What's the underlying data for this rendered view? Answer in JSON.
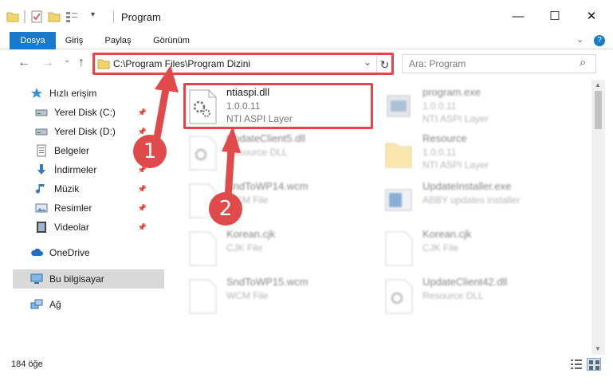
{
  "window": {
    "title": "Program",
    "minimize": "—",
    "maximize": "☐",
    "close": "✕"
  },
  "ribbon": {
    "tabs": [
      "Dosya",
      "Giriş",
      "Paylaş",
      "Görünüm"
    ],
    "collapse": "⌄",
    "help": "?"
  },
  "nav": {
    "back": "←",
    "forward": "→",
    "recent": "⌄",
    "up": "↑",
    "address": "C:\\Program Files\\Program Dizini",
    "address_dropdown": "⌄",
    "refresh": "↻",
    "search_placeholder": "Ara: Program",
    "search_icon": "⌕"
  },
  "sidebar": {
    "items": [
      {
        "label": "Hızlı erişim",
        "icon": "star-icon"
      },
      {
        "label": "Yerel Disk (C:)",
        "icon": "drive-icon"
      },
      {
        "label": "Yerel Disk (D:)",
        "icon": "drive-icon"
      },
      {
        "label": "Belgeler",
        "icon": "documents-icon"
      },
      {
        "label": "İndirmeler",
        "icon": "download-icon"
      },
      {
        "label": "Müzik",
        "icon": "music-icon"
      },
      {
        "label": "Resimler",
        "icon": "pictures-icon"
      },
      {
        "label": "Videolar",
        "icon": "video-icon"
      },
      {
        "label": "OneDrive",
        "icon": "cloud-icon"
      },
      {
        "label": "Bu bilgisayar",
        "icon": "computer-icon"
      },
      {
        "label": "Ağ",
        "icon": "network-icon"
      }
    ]
  },
  "files": [
    {
      "name": "ntiaspi.dll",
      "line2": "1.0.0.11",
      "line3": "NTI ASPI Layer"
    },
    {
      "name": "program.exe",
      "line2": "1.0.0.11",
      "line3": "NTI ASPI Layer"
    },
    {
      "name": "UpdateClient5.dll",
      "line2": "Resource DLL",
      "line3": ""
    },
    {
      "name": "Resource",
      "line2": "1.0.0.11",
      "line3": "NTI ASPI Layer"
    },
    {
      "name": "SndToWP14.wcm",
      "line2": "WCM File",
      "line3": ""
    },
    {
      "name": "UpdateInstaller.exe",
      "line2": "ABBY updates installer",
      "line3": ""
    },
    {
      "name": "Korean.cjk",
      "line2": "CJK File",
      "line3": ""
    },
    {
      "name": "Korean.cjk",
      "line2": "CJK File",
      "line3": ""
    },
    {
      "name": "SndToWP15.wcm",
      "line2": "WCM File",
      "line3": ""
    },
    {
      "name": "UpdateClient42.dll",
      "line2": "Resource DLL",
      "line3": ""
    }
  ],
  "status": {
    "count": "184 öğe"
  },
  "annotations": {
    "badge1": "1",
    "badge2": "2",
    "color": "#e64545"
  }
}
